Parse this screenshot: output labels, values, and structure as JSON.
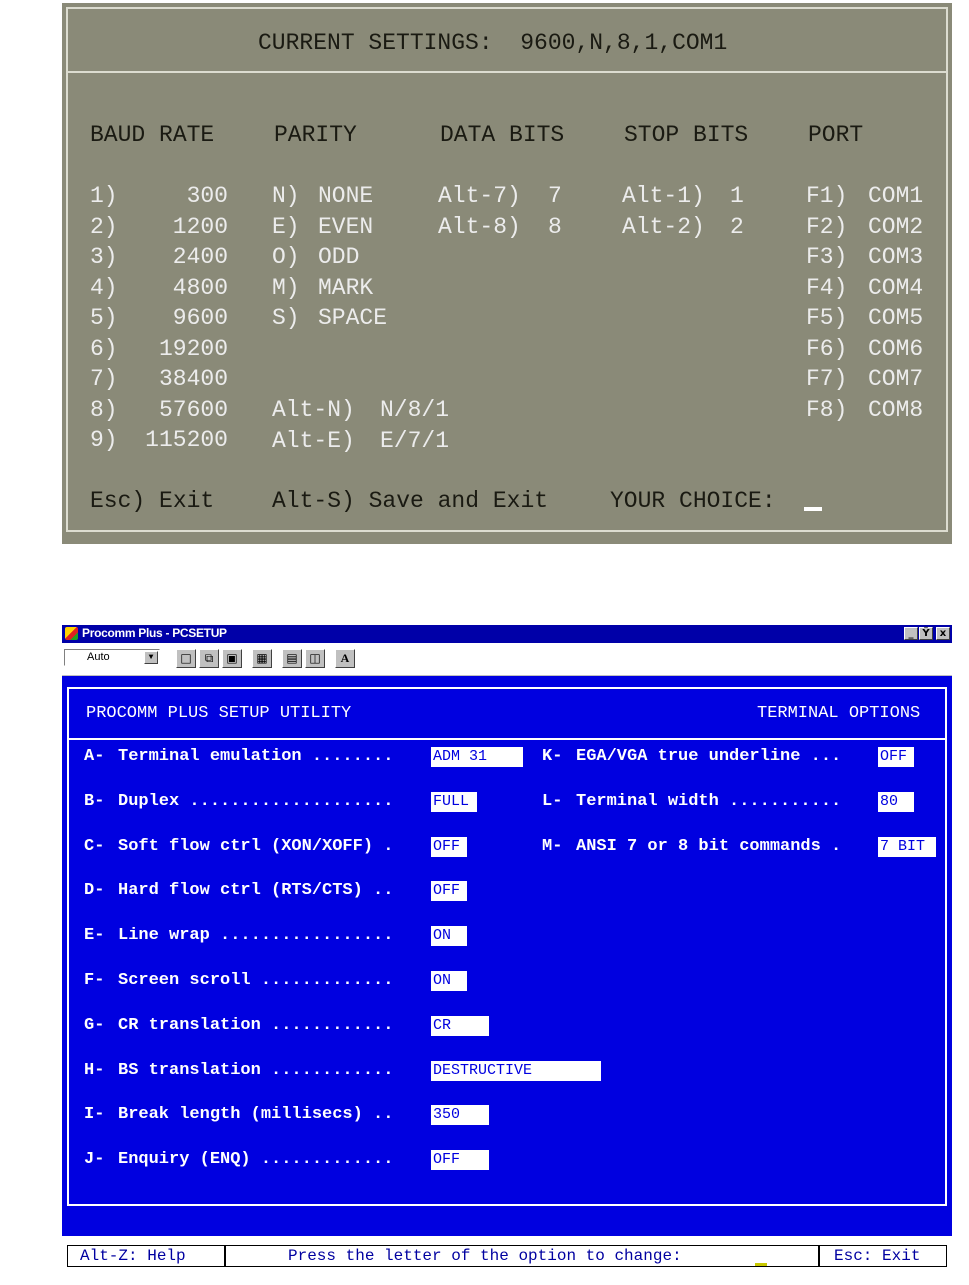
{
  "dos_settings": {
    "header": "CURRENT SETTINGS:  9600,N,8,1,COM1",
    "columns": [
      "BAUD RATE",
      "PARITY",
      "DATA BITS",
      "STOP BITS",
      "PORT"
    ],
    "baud_rates": [
      {
        "key": "1)",
        "value": "300"
      },
      {
        "key": "2)",
        "value": "1200"
      },
      {
        "key": "3)",
        "value": "2400"
      },
      {
        "key": "4)",
        "value": "4800"
      },
      {
        "key": "5)",
        "value": "9600"
      },
      {
        "key": "6)",
        "value": "19200"
      },
      {
        "key": "7)",
        "value": "38400"
      },
      {
        "key": "8)",
        "value": "57600"
      },
      {
        "key": "9)",
        "value": "115200"
      }
    ],
    "parity": [
      {
        "key": "N)",
        "value": "NONE"
      },
      {
        "key": "E)",
        "value": "EVEN"
      },
      {
        "key": "O)",
        "value": "ODD"
      },
      {
        "key": "M)",
        "value": "MARK"
      },
      {
        "key": "S)",
        "value": "SPACE"
      }
    ],
    "parity_shortcuts": [
      {
        "key": "Alt-N)",
        "value": "N/8/1"
      },
      {
        "key": "Alt-E)",
        "value": "E/7/1"
      }
    ],
    "data_bits": [
      {
        "key": "Alt-7)",
        "value": "7"
      },
      {
        "key": "Alt-8)",
        "value": "8"
      }
    ],
    "stop_bits": [
      {
        "key": "Alt-1)",
        "value": "1"
      },
      {
        "key": "Alt-2)",
        "value": "2"
      }
    ],
    "ports": [
      {
        "key": "F1)",
        "value": "COM1"
      },
      {
        "key": "F2)",
        "value": "COM2"
      },
      {
        "key": "F3)",
        "value": "COM3"
      },
      {
        "key": "F4)",
        "value": "COM4"
      },
      {
        "key": "F5)",
        "value": "COM5"
      },
      {
        "key": "F6)",
        "value": "COM6"
      },
      {
        "key": "F7)",
        "value": "COM7"
      },
      {
        "key": "F8)",
        "value": "COM8"
      }
    ],
    "footer": {
      "exit": "Esc) Exit",
      "save": "Alt-S) Save and Exit",
      "prompt": "YOUR CHOICE:"
    }
  },
  "procomm": {
    "window_title": "Procomm Plus - PCSETUP",
    "window_buttons": [
      "_",
      "Ÿ",
      "x"
    ],
    "toolbar": {
      "font_select": "Auto",
      "icons": [
        "mark-icon",
        "copy-icon",
        "paste-icon",
        "fullscreen-icon",
        "properties-icon",
        "background-icon",
        "font-icon"
      ]
    },
    "header_left": "PROCOMM PLUS SETUP UTILITY",
    "header_right": "TERMINAL OPTIONS",
    "options_left": [
      {
        "key": "A-",
        "label": "Terminal emulation ........",
        "value": "ADM 31"
      },
      {
        "key": "B-",
        "label": "Duplex ....................",
        "value": "FULL"
      },
      {
        "key": "C-",
        "label": "Soft flow ctrl (XON/XOFF) .",
        "value": "OFF"
      },
      {
        "key": "D-",
        "label": "Hard flow ctrl (RTS/CTS) ..",
        "value": "OFF"
      },
      {
        "key": "E-",
        "label": "Line wrap .................",
        "value": "ON"
      },
      {
        "key": "F-",
        "label": "Screen scroll .............",
        "value": "ON"
      },
      {
        "key": "G-",
        "label": "CR translation ............",
        "value": "CR"
      },
      {
        "key": "H-",
        "label": "BS translation ............",
        "value": "DESTRUCTIVE"
      },
      {
        "key": "I-",
        "label": "Break length (millisecs) ..",
        "value": "350"
      },
      {
        "key": "J-",
        "label": "Enquiry (ENQ) .............",
        "value": "OFF"
      }
    ],
    "options_right": [
      {
        "key": "K-",
        "label": "EGA/VGA true underline ...",
        "value": "OFF"
      },
      {
        "key": "L-",
        "label": "Terminal width ...........",
        "value": "80"
      },
      {
        "key": "M-",
        "label": "ANSI 7 or 8 bit commands .",
        "value": "7 BIT"
      }
    ],
    "status": {
      "help": "Alt-Z: Help",
      "prompt": "Press the letter of the option to change:",
      "exit": "Esc: Exit"
    }
  }
}
